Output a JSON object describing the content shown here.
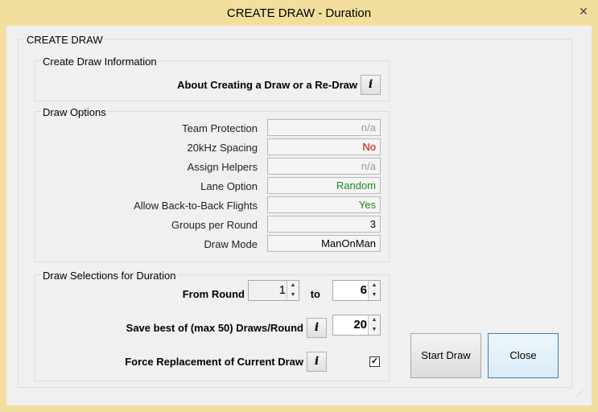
{
  "window": {
    "title": "CREATE DRAW - Duration",
    "close_glyph": "✕"
  },
  "main_group": {
    "legend": "CREATE DRAW"
  },
  "info_group": {
    "legend": "Create Draw Information",
    "about_label": "About Creating a Draw or a Re-Draw",
    "info_glyph": "i"
  },
  "options_group": {
    "legend": "Draw Options",
    "rows": [
      {
        "label": "Team Protection",
        "value": "n/a",
        "color": "#9a9a9a"
      },
      {
        "label": "20kHz Spacing",
        "value": "No",
        "color": "#cc0000"
      },
      {
        "label": "Assign Helpers",
        "value": "n/a",
        "color": "#9a9a9a"
      },
      {
        "label": "Lane Option",
        "value": "Random",
        "color": "#1a8a1a"
      },
      {
        "label": "Allow Back-to-Back Flights",
        "value": "Yes",
        "color": "#1a8a1a"
      },
      {
        "label": "Groups per Round",
        "value": "3",
        "color": "#000000"
      },
      {
        "label": "Draw Mode",
        "value": "ManOnMan",
        "color": "#000000"
      }
    ]
  },
  "selections_group": {
    "legend": "Draw Selections for Duration",
    "from_round_label": "From Round",
    "from_round_value": "1",
    "to_label": "to",
    "to_value": "6",
    "save_best_label": "Save best of (max 50) Draws/Round",
    "save_best_value": "20",
    "force_label": "Force Replacement of Current Draw",
    "force_checked": "✓"
  },
  "buttons": {
    "start_draw": "Start Draw",
    "close": "Close"
  },
  "grip_glyph": "⋰"
}
